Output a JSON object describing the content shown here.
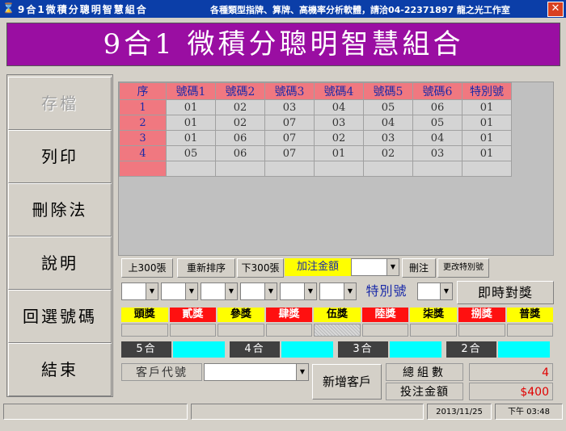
{
  "window": {
    "title": "9合1微積分聰明智慧組合",
    "subtitle": "各種類型指牌、算牌、高機率分析軟體，請洽04-22371897 龍之光工作室",
    "close_glyph": "✕"
  },
  "banner": {
    "text": "9合1 微積分聰明智慧組合"
  },
  "sidebar": {
    "items": [
      {
        "label": "存檔",
        "enabled": false
      },
      {
        "label": "列印",
        "enabled": true
      },
      {
        "label": "刪除法",
        "enabled": true
      },
      {
        "label": "說明",
        "enabled": true
      },
      {
        "label": "回選號碼",
        "enabled": true
      },
      {
        "label": "結束",
        "enabled": true
      }
    ]
  },
  "table": {
    "headers": [
      "序",
      "號碼1",
      "號碼2",
      "號碼3",
      "號碼4",
      "號碼5",
      "號碼6",
      "特別號"
    ],
    "rows": [
      [
        "1",
        "01",
        "02",
        "03",
        "04",
        "05",
        "06",
        "01"
      ],
      [
        "2",
        "01",
        "02",
        "07",
        "03",
        "04",
        "05",
        "01"
      ],
      [
        "3",
        "01",
        "06",
        "07",
        "02",
        "03",
        "04",
        "01"
      ],
      [
        "4",
        "05",
        "06",
        "07",
        "01",
        "02",
        "03",
        "01"
      ]
    ]
  },
  "toolbar": {
    "prev300": "上300張",
    "resort": "重新排序",
    "next300": "下300張",
    "add_amount_label": "加注金額",
    "delete_bet": "刪注",
    "change_special": "更改特別號"
  },
  "draw_row": {
    "special_label": "特別號",
    "instant_check": "即時對獎"
  },
  "prizes": [
    {
      "label": "頭獎",
      "color": "#ffff00"
    },
    {
      "label": "貳獎",
      "color": "#ff1010"
    },
    {
      "label": "參獎",
      "color": "#ffff00"
    },
    {
      "label": "肆獎",
      "color": "#ff1010"
    },
    {
      "label": "伍獎",
      "color": "#ffff00"
    },
    {
      "label": "陸獎",
      "color": "#ff1010"
    },
    {
      "label": "柒獎",
      "color": "#ffff00"
    },
    {
      "label": "捌獎",
      "color": "#ff1010"
    },
    {
      "label": "普獎",
      "color": "#ffff00"
    }
  ],
  "matches": [
    "5合",
    "4合",
    "3合",
    "2合"
  ],
  "customer": {
    "code_label": "客戶代號",
    "add_button": "新增客戶"
  },
  "summary": {
    "total_label": "總組數",
    "total_value": "4",
    "amount_label": "投注金額",
    "amount_value": "$400"
  },
  "statusbar": {
    "date": "2013/11/25",
    "time": "下午 03:48"
  }
}
